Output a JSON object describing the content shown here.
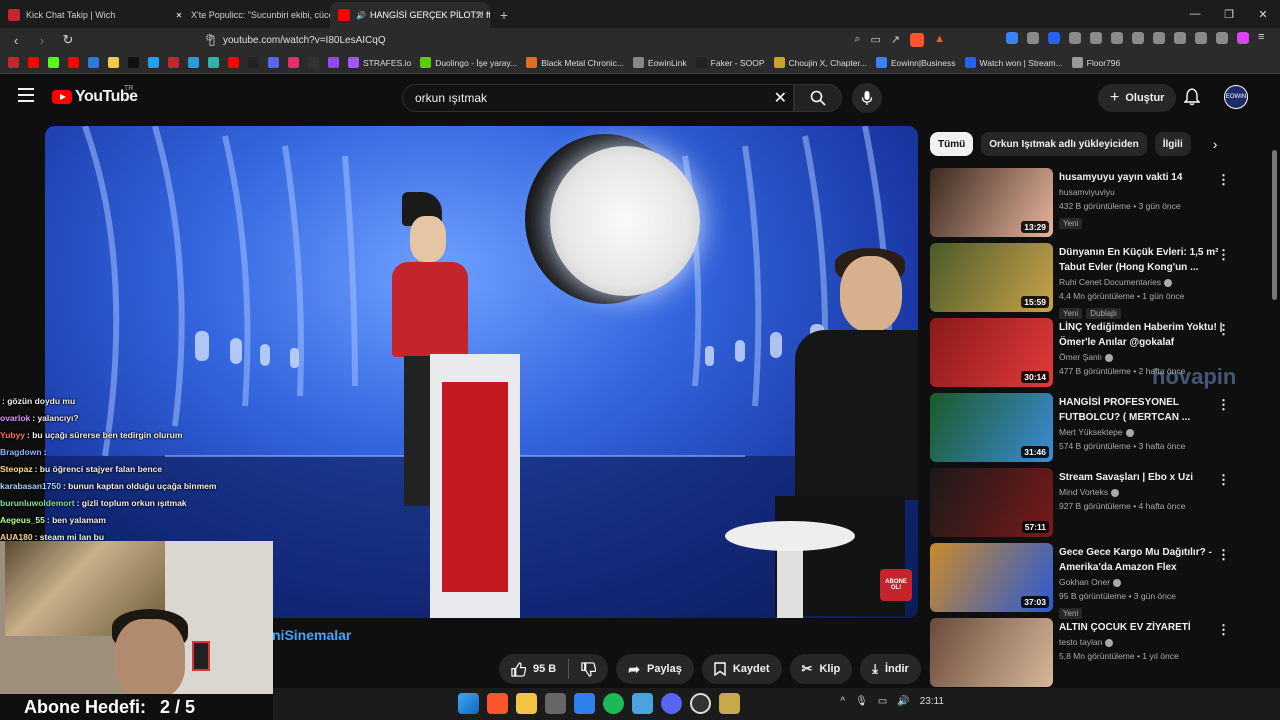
{
  "browser": {
    "tabs": [
      {
        "title": "Kick Chat Takip | Wich",
        "active": false
      },
      {
        "title": "X'te Populicc: \"Sucunbiri ekibi, cücele",
        "active": false
      },
      {
        "title": "HANGİSİ GERÇEK PİLOT?! ft. Ö",
        "active": true
      }
    ],
    "url": "youtube.com/watch?v=I80LesAICqQ",
    "bookmarks": [
      {
        "label": "",
        "color": "#c3262c"
      },
      {
        "label": "",
        "color": "#ff0000"
      },
      {
        "label": "",
        "color": "#53fc18"
      },
      {
        "label": "",
        "color": "#ff0000"
      },
      {
        "label": "",
        "color": "#2c7bd7"
      },
      {
        "label": "",
        "color": "#f2c94c"
      },
      {
        "label": "",
        "color": "#111111"
      },
      {
        "label": "",
        "color": "#1da1f2"
      },
      {
        "label": "",
        "color": "#c3262c"
      },
      {
        "label": "",
        "color": "#2c9bd8"
      },
      {
        "label": "",
        "color": "#2bb6a8"
      },
      {
        "label": "",
        "color": "#ff0000"
      },
      {
        "label": "",
        "color": "#222222"
      },
      {
        "label": "",
        "color": "#5865f2"
      },
      {
        "label": "",
        "color": "#e1306c"
      },
      {
        "label": "",
        "color": "#333333"
      },
      {
        "label": "",
        "color": "#9146ff"
      },
      {
        "label": "STRAFES.io",
        "color": "#a855f7"
      },
      {
        "label": "Duolingo - İşe yaray...",
        "color": "#58cc02"
      },
      {
        "label": "Black Metal Chronic...",
        "color": "#e06c2b"
      },
      {
        "label": "EowinLink",
        "color": "#888888"
      },
      {
        "label": "Faker - SOOP",
        "color": "#222222"
      },
      {
        "label": "Choujin X, Chapter...",
        "color": "#c9a227"
      },
      {
        "label": "Eowinn|Business",
        "color": "#3b82f6"
      },
      {
        "label": "Watch won | Stream...",
        "color": "#2563eb"
      },
      {
        "label": "Floor796",
        "color": "#999999"
      }
    ]
  },
  "youtube": {
    "logo_text": "YouTube",
    "region": "TR",
    "search_value": "orkun ışıtmak",
    "create_label": "Oluştur",
    "avatar_text": "EOWIN"
  },
  "video": {
    "channel_name_partial": "niSinemalar",
    "like_count": "95 B",
    "share_label": "Paylaş",
    "save_label": "Kaydet",
    "clip_label": "Klip",
    "download_label": "İndir",
    "subscribe_badge": "ABONE OL!"
  },
  "chat": [
    {
      "user": "",
      "user_color": "#ffffff",
      "text": ": gözün doydu mu"
    },
    {
      "user": "ovarlok",
      "user_color": "#e58cff",
      "text": ": yalancıyı?"
    },
    {
      "user": "Yubyy",
      "user_color": "#ff6b6b",
      "text": ": bu uçağı sürerse ben tedirgin olurum"
    },
    {
      "user": "Bragdown",
      "user_color": "#8fb6ff",
      "text": ":"
    },
    {
      "user": "Steopaz",
      "user_color": "#ffe066",
      "text": ": bu öğrenci stajyer falan bence"
    },
    {
      "user": "karabasan1750",
      "user_color": "#9fd3ff",
      "text": ": bunun kaptan olduğu uçağa binmem"
    },
    {
      "user": "burunluwoldemort",
      "user_color": "#7ee0a0",
      "text": ": gizli toplum orkun ışıtmak"
    },
    {
      "user": "Aegeus_55",
      "user_color": "#b8ff8c",
      "text": ": ben yalamam"
    },
    {
      "user": "AUA180",
      "user_color": "#ffd27a",
      "text": ": steam mi lan bu"
    }
  ],
  "stream_goal": {
    "label": "Abone Hedefi:",
    "value": "2 / 5"
  },
  "sidebar": {
    "chips": [
      "Tümü",
      "Orkun Işıtmak adlı yükleyiciden",
      "İlgili"
    ],
    "recommendations": [
      {
        "title": "husamyuyu yayın vakti 14",
        "channel": "husamviyuviyu",
        "stats": "432 B görüntüleme • 3 gün önce",
        "badges": [
          "Yeni"
        ],
        "duration": "13:29",
        "verified": false,
        "thumb_a": "#3a2a20",
        "thumb_b": "#e8b49c"
      },
      {
        "title": "Dünyanın En Küçük Evleri: 1,5 m² Tabut Evler (Hong Kong'un ...",
        "channel": "Ruhi Cenet Documentaries",
        "stats": "4,4 Mn görüntüleme • 1 gün önce",
        "badges": [
          "Yeni",
          "Dublajlı"
        ],
        "duration": "15:59",
        "verified": true,
        "thumb_a": "#4a5a2a",
        "thumb_b": "#c9a24a"
      },
      {
        "title": "LİNÇ Yediğimden Haberim Yoktu! | Ömer'le Anılar @gokalaf",
        "channel": "Ömer Şanlı",
        "stats": "477 B görüntüleme • 2 hafta önce",
        "badges": [],
        "duration": "30:14",
        "verified": true,
        "thumb_a": "#8a1a1a",
        "thumb_b": "#e23a3a"
      },
      {
        "title": "HANGİSİ PROFESYONEL FUTBOLCU? ( MERTCAN ...",
        "channel": "Mert Yüksektepe",
        "stats": "574 B görüntüleme • 3 hafta önce",
        "badges": [],
        "duration": "31:46",
        "verified": true,
        "thumb_a": "#1b5a2a",
        "thumb_b": "#3c8bd6"
      },
      {
        "title": "Stream Savaşları | Ebo x Uzi",
        "channel": "Mind Vorteks",
        "stats": "927 B görüntüleme • 4 hafta önce",
        "badges": [],
        "duration": "57:11",
        "verified": true,
        "thumb_a": "#1a1a1a",
        "thumb_b": "#7a1a1a"
      },
      {
        "title": "Gece Gece Kargo Mu Dağıtılır? - Amerika'da Amazon Flex",
        "channel": "Gokhan Oner",
        "stats": "95 B görüntüleme • 3 gün önce",
        "badges": [
          "Yeni"
        ],
        "duration": "37:03",
        "verified": true,
        "thumb_a": "#c98a2a",
        "thumb_b": "#2a5ad6"
      },
      {
        "title": "ALTIN ÇOCUK EV ZİYARETİ",
        "channel": "testo taylan",
        "stats": "5,8 Mn görüntüleme • 1 yıl önce",
        "badges": [],
        "duration": "",
        "verified": true,
        "thumb_a": "#6a4a3a",
        "thumb_b": "#d6b89a"
      }
    ]
  },
  "watermark": "hovapin",
  "taskbar": {
    "time": "23:11"
  }
}
